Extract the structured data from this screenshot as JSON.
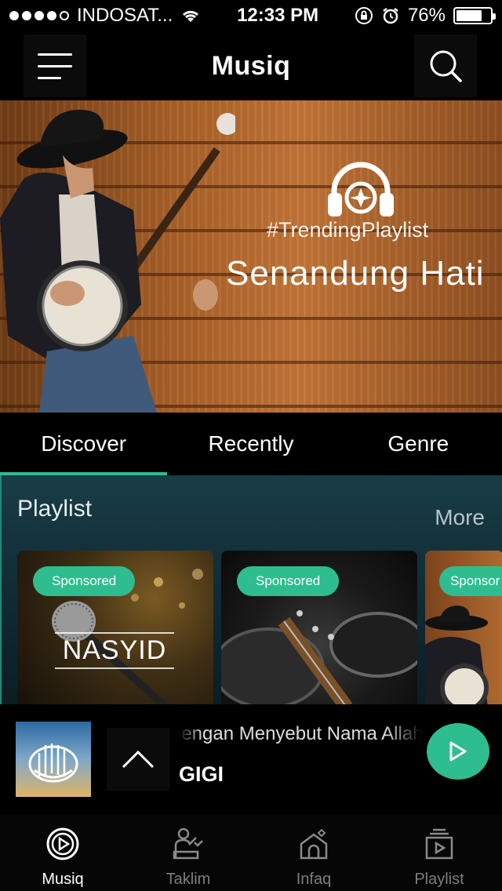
{
  "status_bar": {
    "carrier": "INDOSAT...",
    "time": "12:33 PM",
    "battery": "76%",
    "battery_level": 0.76
  },
  "header": {
    "title": "Musiq",
    "menu_icon": "hamburger-icon",
    "search_icon": "search-icon"
  },
  "banner": {
    "tag": "#TrendingPlaylist",
    "title": "Senandung Hati",
    "logo_icon": "headphones-logo-icon"
  },
  "tabs": [
    {
      "label": "Discover",
      "active": true
    },
    {
      "label": "Recently",
      "active": false
    },
    {
      "label": "Genre",
      "active": false
    }
  ],
  "playlist_section": {
    "title": "Playlist",
    "more_label": "More",
    "cards": [
      {
        "badge": "Sponsored",
        "overlay_text": "NASYID"
      },
      {
        "badge": "Sponsored"
      },
      {
        "badge": "Sponsor"
      }
    ]
  },
  "now_playing": {
    "title": "Dengan Menyebut Nama Allah",
    "artist": "GIGI",
    "expand_icon": "chevron-up-icon",
    "play_icon": "play-icon"
  },
  "bottom_nav": [
    {
      "label": "Musiq",
      "icon": "play-circle-icon",
      "active": true
    },
    {
      "label": "Taklim",
      "icon": "teacher-icon",
      "active": false
    },
    {
      "label": "Infaq",
      "icon": "mosque-icon",
      "active": false
    },
    {
      "label": "Playlist",
      "icon": "playlist-icon",
      "active": false
    }
  ],
  "colors": {
    "accent": "#2ebd8e",
    "background": "#000000",
    "section_bg": "#183d46"
  }
}
